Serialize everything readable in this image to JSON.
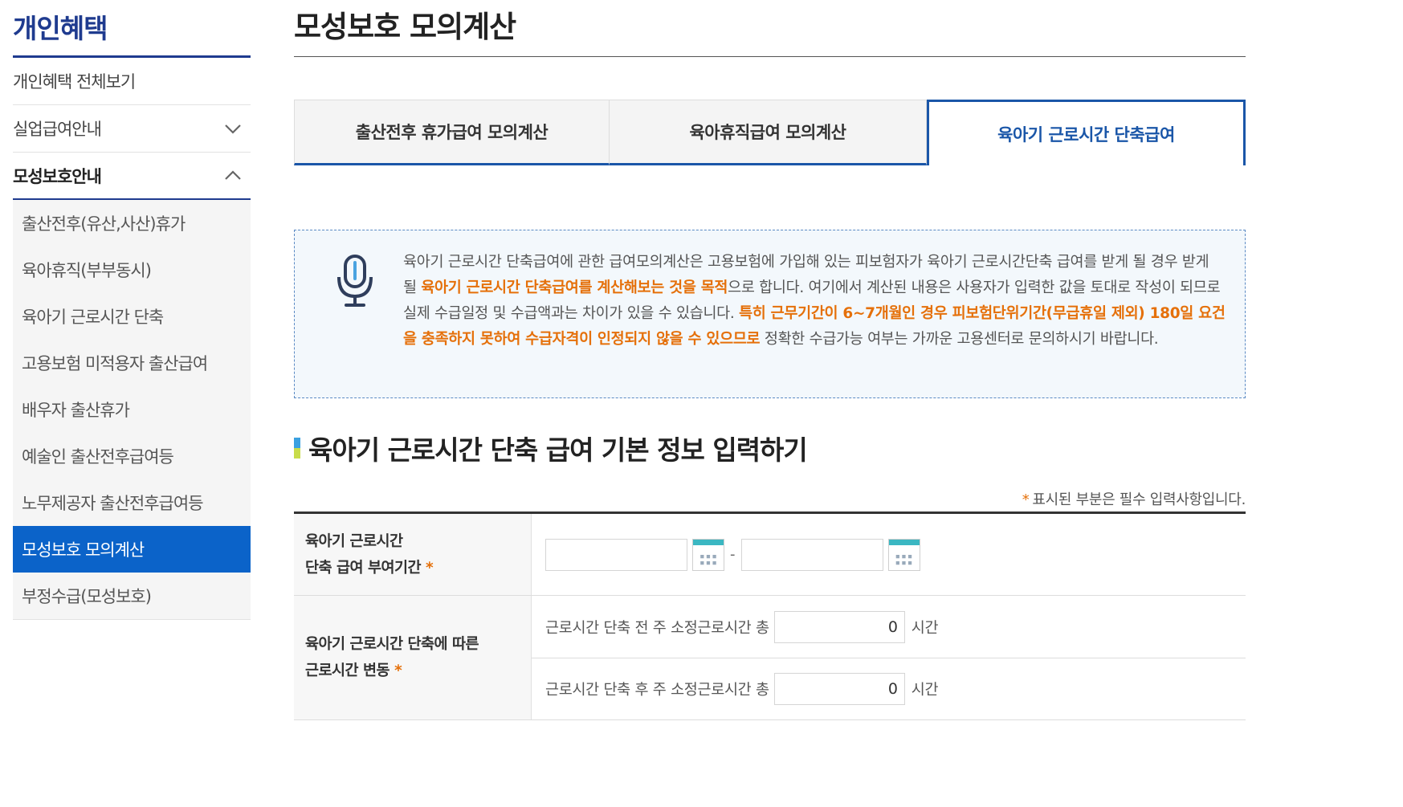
{
  "sidebar": {
    "title": "개인혜택",
    "items": [
      {
        "label": "개인혜택 전체보기"
      },
      {
        "label": "실업급여안내"
      },
      {
        "label": "모성보호안내"
      }
    ],
    "sub_items": [
      {
        "label": "출산전후(유산,사산)휴가"
      },
      {
        "label": "육아휴직(부부동시)"
      },
      {
        "label": "육아기 근로시간 단축"
      },
      {
        "label": "고용보험 미적용자 출산급여"
      },
      {
        "label": "배우자 출산휴가"
      },
      {
        "label": "예술인 출산전후급여등"
      },
      {
        "label": "노무제공자 출산전후급여등"
      },
      {
        "label": "모성보호 모의계산"
      },
      {
        "label": "부정수급(모성보호)"
      }
    ]
  },
  "main": {
    "page_title": "모성보호 모의계산",
    "tabs": [
      {
        "label": "출산전후 휴가급여 모의계산"
      },
      {
        "label": "육아휴직급여 모의계산"
      },
      {
        "label": "육아기 근로시간 단축급여"
      }
    ],
    "notice": {
      "t1": "육아기 근로시간 단축급여에 관한 급여모의계산은 고용보험에 가입해 있는 피보험자가 육아기 근로시간단축 급여를 받게 될 경우 받게 될 ",
      "h1": "육아기 근로시간 단축급여를 계산해보는 것을 목적",
      "t2": "으로 합니다. 여기에서 계산된 내용은 사용자가 입력한 값을 토대로 작성이 되므로 실제 수급일정 및 수급액과는 차이가 있을 수 있습니다. ",
      "h2": "특히 근무기간이 6~7개월인 경우 피보험단위기간(무급휴일 제외) 180일 요건을 충족하지 못하여 수급자격이 인정되지 않을 수 있으므로",
      "t3": " 정확한 수급가능 여부는 가까운 고용센터로 문의하시기 바랍니다."
    },
    "section_title": "육아기 근로시간 단축 급여 기본 정보 입력하기",
    "required_note": "표시된 부분은 필수 입력사항입니다.",
    "required_star": "*",
    "form": {
      "period_label_1": "육아기 근로시간",
      "period_label_2": "단축 급여 부여기간",
      "date_sep": "-",
      "change_label_1": "육아기 근로시간 단축에 따른",
      "change_label_2": "근로시간 변동",
      "before_label": "근로시간 단축 전 주 소정근로시간 총",
      "before_value": "0",
      "after_label": "근로시간 단축 후 주 소정근로시간 총",
      "after_value": "0",
      "unit": "시간"
    }
  }
}
